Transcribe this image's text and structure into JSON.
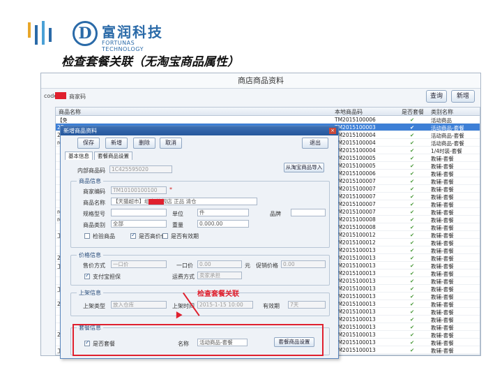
{
  "logo": {
    "glyph": "D",
    "name_cn": "富润科技",
    "name_en": "FORTUNAS TECHNOLOGY",
    "colors": {
      "bar1": "#e8a72a",
      "bar2": "#2a6aa8",
      "bar3": "#4aa0d6",
      "brand": "#2a6aa8"
    }
  },
  "heading": "检查套餐关联（无淘宝商品属性）",
  "window": {
    "title": "商店商品资料",
    "search_label": "code",
    "search_after": "商家码",
    "query_button": "查询",
    "add_button": "新增"
  },
  "grid": {
    "headers": {
      "name": "商品名称",
      "code": "本地商品码",
      "status": "是否套餐",
      "category": "类别名称"
    },
    "rows": [
      {
        "name": "【免",
        "code": "TM2015100006",
        "chk": "✔",
        "cat": "活动商品"
      },
      {
        "name": "2E",
        "code": "TM2015100003",
        "chk": "✔",
        "cat": "活动商品-套餐",
        "selected": true
      },
      {
        "name": "2E",
        "code": "TM2015100004",
        "chk": "✔",
        "cat": "活动商品-套餐"
      },
      {
        "name": "ro",
        "code": "TM2015100004",
        "chk": "✔",
        "cat": "活动商品-套餐"
      },
      {
        "name": "【免",
        "code": "TM2015100004",
        "chk": "✔",
        "cat": "1/4时装-套餐"
      },
      {
        "name": "【标",
        "code": "TM2015100005",
        "chk": "✔",
        "cat": "教辅-套餐"
      },
      {
        "name": "【免",
        "code": "TM2015100005",
        "chk": "✔",
        "cat": "教辅-套餐"
      },
      {
        "name": "【标",
        "code": "TM2015100006",
        "chk": "✔",
        "cat": "教辅-套餐"
      },
      {
        "name": "【免",
        "code": "TM2015100007",
        "chk": "✔",
        "cat": "教辅-套餐"
      },
      {
        "name": "【标",
        "code": "TM2015100007",
        "chk": "✔",
        "cat": "教辅-套餐"
      },
      {
        "name": "【免",
        "code": "TM2015100007",
        "chk": "✔",
        "cat": "教辅-套餐"
      },
      {
        "name": "【标",
        "code": "TM2015100007",
        "chk": "✔",
        "cat": "教辅-套餐"
      },
      {
        "name": "ro",
        "code": "TM2015100007",
        "chk": "✔",
        "cat": "教辅-套餐"
      },
      {
        "name": "ro",
        "code": "TM2015100008",
        "chk": "✔",
        "cat": "教辅-套餐"
      },
      {
        "name": "【免",
        "code": "TM2015100008",
        "chk": "✔",
        "cat": "教辅-套餐"
      },
      {
        "name": "工",
        "code": "TM2015100012",
        "chk": "✔",
        "cat": "教辅-套餐"
      },
      {
        "name": "【标",
        "code": "TM2015100012",
        "chk": "✔",
        "cat": "教辅-套餐"
      },
      {
        "name": "【免",
        "code": "TM2015100013",
        "chk": "✔",
        "cat": "教辅-套餐"
      },
      {
        "name": "2E",
        "code": "TM2015100013",
        "chk": "✔",
        "cat": "教辅-套餐"
      },
      {
        "name": "工",
        "code": "TM2015100013",
        "chk": "✔",
        "cat": "教辅-套餐"
      },
      {
        "name": "【标",
        "code": "TM2015100013",
        "chk": "✔",
        "cat": "教辅-套餐"
      },
      {
        "name": "【免",
        "code": "TM2015100013",
        "chk": "✔",
        "cat": "教辅-套餐"
      },
      {
        "name": "工",
        "code": "TM2015100013",
        "chk": "✔",
        "cat": "教辅-套餐"
      },
      {
        "name": "【标",
        "code": "TM2015100013",
        "chk": "✔",
        "cat": "教辅-套餐"
      },
      {
        "name": "2E",
        "code": "TM2015100013",
        "chk": "✔",
        "cat": "教辅-套餐"
      },
      {
        "name": "【免",
        "code": "TM2015100013",
        "chk": "✔",
        "cat": "教辅-套餐"
      },
      {
        "name": "【标",
        "code": "TM2015100013",
        "chk": "✔",
        "cat": "教辅-套餐"
      },
      {
        "name": "【免",
        "code": "TM2015100013",
        "chk": "✔",
        "cat": "教辅-套餐"
      },
      {
        "name": "2E",
        "code": "TM2015100013",
        "chk": "✔",
        "cat": "教辅-套餐"
      },
      {
        "name": "【标",
        "code": "TM2015100013",
        "chk": "✔",
        "cat": "教辅-套餐"
      },
      {
        "name": "工",
        "code": "TM2015100013",
        "chk": "✔",
        "cat": "教辅-套餐"
      }
    ]
  },
  "dialog": {
    "title": "新增商品资料",
    "close": "×",
    "buttons": {
      "save": "保存",
      "new": "新增",
      "delete": "删除",
      "cancel": "取消",
      "exit": "退出"
    },
    "tabs": [
      "基本信息",
      "套餐商品设置"
    ],
    "goods_code_label": "内部商品码",
    "goods_code_value": "1C425595020",
    "sync_button": "从淘宝商品导入",
    "sec_product": "商品信息",
    "fields": {
      "merchant_code_label": "商家编码",
      "merchant_code_value": "TM10100100100",
      "name_label": "商品名称",
      "name_value": "【天猫超市】组合 旗舰店 正品 清仓",
      "model_label": "规格型号",
      "unit_label": "单位",
      "unit_value": "件",
      "brand_label": "品牌",
      "category_label": "商品类别",
      "category_value": "全部",
      "weight_label": "重量",
      "weight_value": "0.000.00",
      "check1": "检验商品",
      "check2": "是否高价值",
      "check3": "是否有效期"
    },
    "sec_price": "价格信息",
    "price": {
      "mode_label": "售价方式",
      "mode_value": "一口价",
      "price_label": "一口价",
      "price_value": "0.00",
      "price_unit": "元",
      "promo_label": "促销价格",
      "promo_value": "0.00",
      "pay_label": "支付宝担保",
      "freight_label": "运费方式",
      "freight_value": "卖家承担"
    },
    "sec_shelf": "上架信息",
    "shelf": {
      "mode_label": "上架类型",
      "mode_value": "放入仓库",
      "time_label": "上架时间",
      "time_value": "2015-1-15 10:00",
      "period_label": "有效期",
      "period_value": "7天"
    },
    "sec_combo": "套餐信息",
    "combo": {
      "check_label": "是否套餐",
      "name_label": "名称",
      "name_value": "活动商品-套餐",
      "button": "套餐商品设置"
    }
  },
  "annotation": "检查套餐关联"
}
